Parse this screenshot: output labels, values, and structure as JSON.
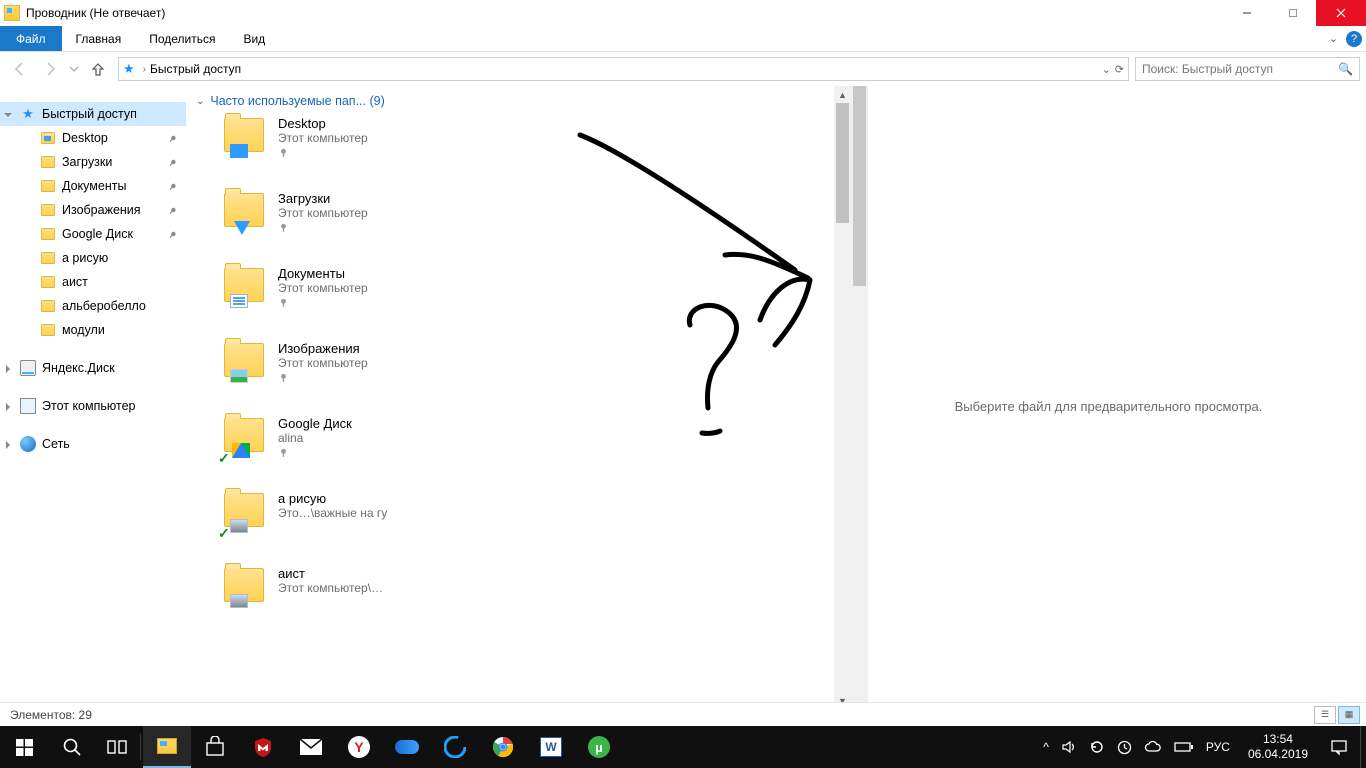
{
  "title": "Проводник (Не отвечает)",
  "ribbon": {
    "file": "Файл",
    "tabs": [
      "Главная",
      "Поделиться",
      "Вид"
    ]
  },
  "address": {
    "crumb": "Быстрый доступ"
  },
  "search": {
    "placeholder": "Поиск: Быстрый доступ"
  },
  "nav": {
    "quick_access": "Быстрый доступ",
    "items": [
      {
        "label": "Desktop",
        "pinned": true
      },
      {
        "label": "Загрузки",
        "pinned": true
      },
      {
        "label": "Документы",
        "pinned": true
      },
      {
        "label": "Изображения",
        "pinned": true
      },
      {
        "label": "Google Диск",
        "pinned": true
      },
      {
        "label": "а рисую",
        "pinned": false
      },
      {
        "label": "аист",
        "pinned": false
      },
      {
        "label": "альберобелло",
        "pinned": false
      },
      {
        "label": "модули",
        "pinned": false
      }
    ],
    "yandex_disk": "Яндекс.Диск",
    "this_pc": "Этот компьютер",
    "network": "Сеть"
  },
  "content": {
    "group_header": "Часто используемые пап... (9)",
    "folders": [
      {
        "name": "Desktop",
        "sub": "Этот компьютер",
        "overlay": "blue",
        "pinned": true
      },
      {
        "name": "Загрузки",
        "sub": "Этот компьютер",
        "overlay": "dlarrow",
        "pinned": true
      },
      {
        "name": "Документы",
        "sub": "Этот компьютер",
        "overlay": "doc",
        "pinned": true
      },
      {
        "name": "Изображения",
        "sub": "Этот компьютер",
        "overlay": "pic",
        "pinned": true
      },
      {
        "name": "Google Диск",
        "sub": "alina",
        "overlay": "gdrive",
        "pinned": true,
        "check": true
      },
      {
        "name": "а рисую",
        "sub": "Это…\\важные на гу",
        "overlay": "photo",
        "pinned": false,
        "check": true
      },
      {
        "name": "аист",
        "sub": "Этот компьютер\\…",
        "overlay": "photo",
        "pinned": false
      }
    ]
  },
  "preview": {
    "message": "Выберите файл для предварительного просмотра."
  },
  "status": {
    "items_label": "Элементов:",
    "items_count": "29"
  },
  "taskbar": {
    "lang": "РУС",
    "time": "13:54",
    "date": "06.04.2019"
  }
}
